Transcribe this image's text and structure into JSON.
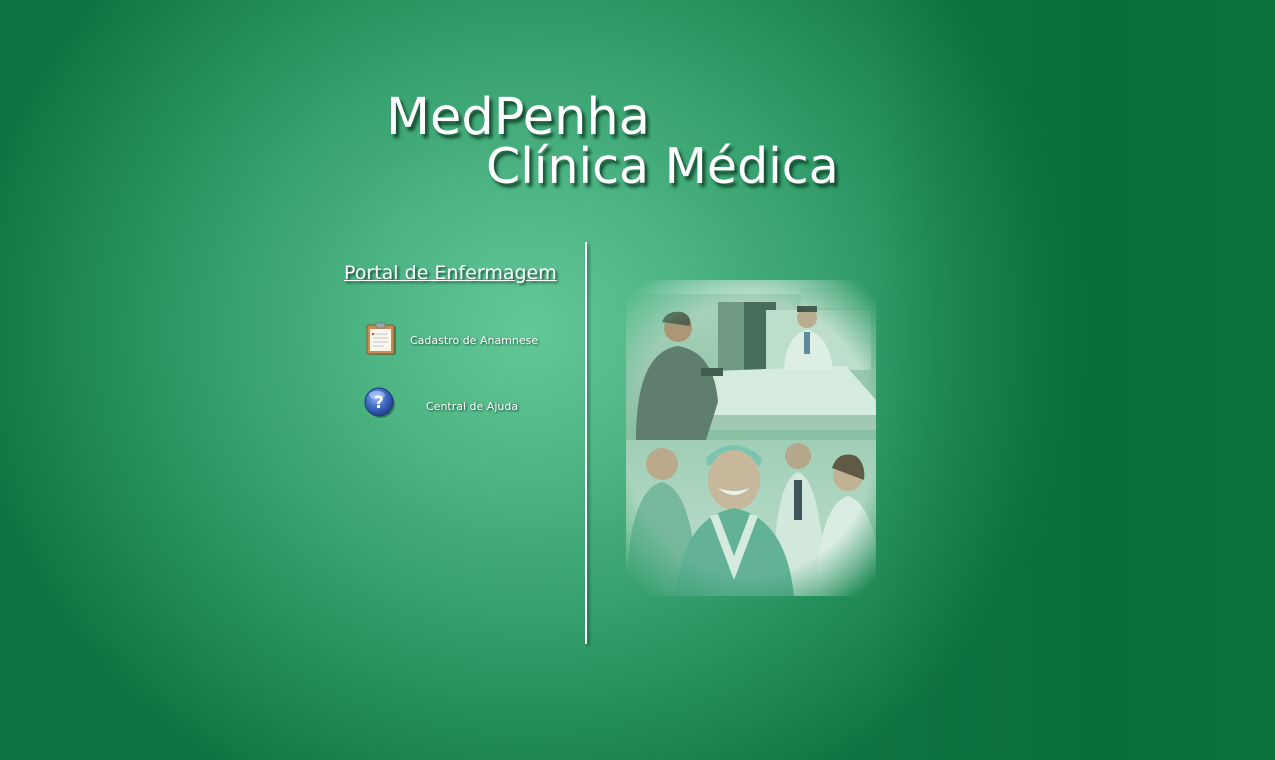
{
  "logo": {
    "line1": "MedPenha",
    "line2": "Clínica Médica"
  },
  "portal": {
    "title": "Portal de Enfermagem"
  },
  "menu": {
    "items": [
      {
        "label": "Cadastro de Anamnese",
        "icon": "clipboard-icon"
      },
      {
        "label": "Central de Ajuda",
        "icon": "help-icon"
      }
    ]
  },
  "colors": {
    "background_green": "#2f9a67",
    "highlight_green": "#63c898",
    "dark_green": "#006d35",
    "text": "#ffffff"
  }
}
